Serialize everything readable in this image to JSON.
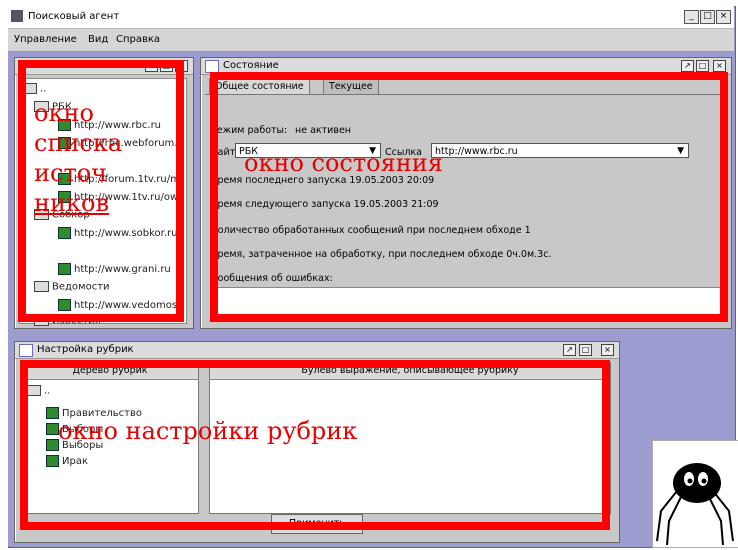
{
  "app": {
    "title": "Поисковый агент",
    "controls": [
      "_",
      "□",
      "×"
    ]
  },
  "menu": [
    "Управление",
    "Вид",
    "Справка"
  ],
  "sources_window": {
    "annotation_lines": [
      "окно",
      "списка",
      "источ",
      "ников"
    ],
    "tree": [
      {
        "type": "folder",
        "label": "РБК"
      },
      {
        "type": "source",
        "label": "http://www.rbc.ru"
      },
      {
        "type": "source",
        "label": "http://rbc.webforum."
      },
      {
        "type": "source",
        "label": "http://forum.1tv.ru/m"
      },
      {
        "type": "source",
        "label": "http://www.1tv.ru/ow"
      },
      {
        "type": "folder",
        "label": "Собкор"
      },
      {
        "type": "source",
        "label": "http://www.sobkor.ru"
      },
      {
        "type": "source",
        "label": "http://www.grani.ru"
      },
      {
        "type": "folder",
        "label": "Ведомости"
      },
      {
        "type": "source",
        "label": "http://www.vedomos"
      },
      {
        "type": "folder",
        "label": "Известия"
      }
    ]
  },
  "status_window": {
    "title": "Состояние",
    "tabs": [
      "Общее состояние",
      "Текущее"
    ],
    "mode_label": "Режим работы:",
    "mode_value": "не активен",
    "site_label": "Сайт",
    "site_value": "РБК",
    "link_label": "Ссылка",
    "link_value": "http://www.rbc.ru",
    "last_run": "Время последнего запуска 19.05.2003 20:09",
    "next_run": "Время следующего запуска 19.05.2003 21:09",
    "processed": "Количество обработанных сообщений при последнем обходе 1",
    "time_spent": "Время, затраченное на обработку, при последнем обходе 0ч.0м.3с.",
    "errors_label": "Сообщения об ошибках:",
    "annotation": "окно состояния"
  },
  "rubric_window": {
    "title": "Настройка рубрик",
    "tree_header": "Дерево рубрик",
    "expr_header": "Булево выражение, описывающее рубрику",
    "rubrics": [
      "Правительство",
      "Выборы",
      "Выборы",
      "Ирак"
    ],
    "button_label": "Применить",
    "annotation": "окно настройки рубрик"
  },
  "colors": {
    "annotation_red": "#ff0000",
    "desktop": "#9c9cd0",
    "panel": "#c8c8c8"
  }
}
